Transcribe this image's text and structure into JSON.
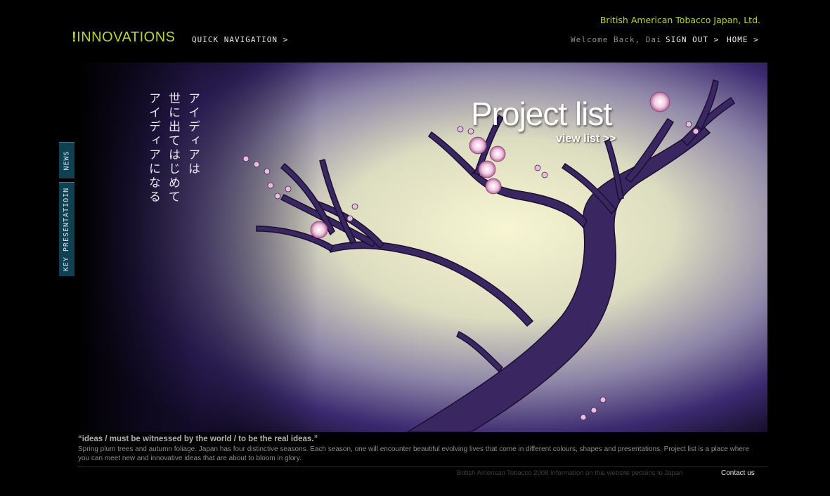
{
  "header": {
    "logo_mark": "!",
    "logo_text": "INNOVATIONS",
    "quick_nav_label": "QUICK NAVIGATION >",
    "company_name": "British American Tobacco Japan, Ltd.",
    "welcome_text": "Welcome Back, Dai",
    "sign_out_label": "SIGN OUT >",
    "home_label": "HOME >"
  },
  "side_tabs": {
    "news_label": "NEWS",
    "key_presentation_label": "KEY PRESENTATIOIN"
  },
  "hero": {
    "vertical_lines": [
      "アイディアは",
      "世に出てはじめて",
      "アイディアになる"
    ],
    "title": "Project list",
    "link_label": "view list >>"
  },
  "caption": {
    "quote": "“ideas / must be witnessed by the world / to be the real ideas.”",
    "description": "Spring plum trees and autumn foliage. Japan has four distinctive seasons. Each season, one will encounter beautiful evolving lives that come in different colours, shapes and presentations. Project list is a place where you can meet new and innovative ideas that are about to bloom in glory."
  },
  "footer": {
    "copyright": "British American Tobacco 2008  Information on this website pertains to Japan",
    "contact_label": "Contact us"
  },
  "colors": {
    "accent_green": "#b6d53a",
    "tab_blue": "#0f4152",
    "branch_purple": "#3a2660"
  }
}
